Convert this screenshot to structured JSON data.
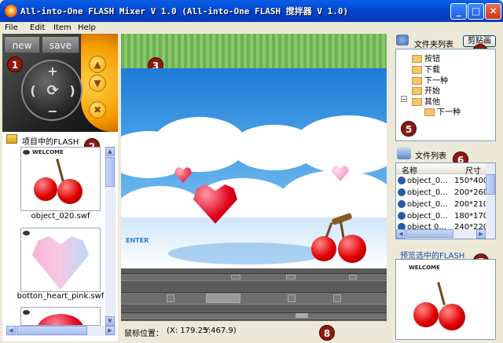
{
  "window": {
    "title": "All-into-One FLASH Mixer V 1.0 (All-into-One FLASH 搅拌器 V 1.0)",
    "minimize": "_",
    "maximize": "□",
    "close": "✕"
  },
  "menu": [
    "File",
    "Edit",
    "Item",
    "Help"
  ],
  "controller": {
    "new_label": "new",
    "save_label": "save",
    "plus": "+",
    "minus": "−",
    "left": "(",
    "right": ")",
    "center": "⟳",
    "up": "▲",
    "down": "▼",
    "x": "✖"
  },
  "left_panel": {
    "header": "项目中的FLASH",
    "items": [
      {
        "name": "object_020.swf",
        "caption": "WELCOME"
      },
      {
        "name": "botton_heart_pink.swf"
      },
      {
        "name": ""
      }
    ]
  },
  "stage": {
    "enter_text": "ENTER"
  },
  "status": {
    "label": "鼠标位置：",
    "x": "(X: 179.25",
    "y": "Y:467.9)"
  },
  "right_panel": {
    "folder_header": "文件夹列表",
    "cut_button": "剪贴画",
    "folders": [
      "按钮",
      "下载",
      "下一种",
      "开始",
      "其他",
      "下一种"
    ],
    "file_header": "文件列表",
    "columns": [
      "名称",
      "尺寸"
    ],
    "files": [
      {
        "name": "object_0...",
        "size": "150*400"
      },
      {
        "name": "object_0...",
        "size": "200*260"
      },
      {
        "name": "object_0...",
        "size": "200*210"
      },
      {
        "name": "object_0...",
        "size": "180*170"
      },
      {
        "name": "object 0...",
        "size": "240*220"
      }
    ],
    "preview_header": "预览选中的FLASH",
    "preview_caption": "WELCOME"
  },
  "badges": [
    "1",
    "2",
    "3",
    "4",
    "5",
    "6",
    "7",
    "8"
  ],
  "colors": {
    "titlebar": "#0A5FE8",
    "badge": "#8B1A0E",
    "stage_sky": "#4BA3E8",
    "heart": "#E0001A"
  }
}
